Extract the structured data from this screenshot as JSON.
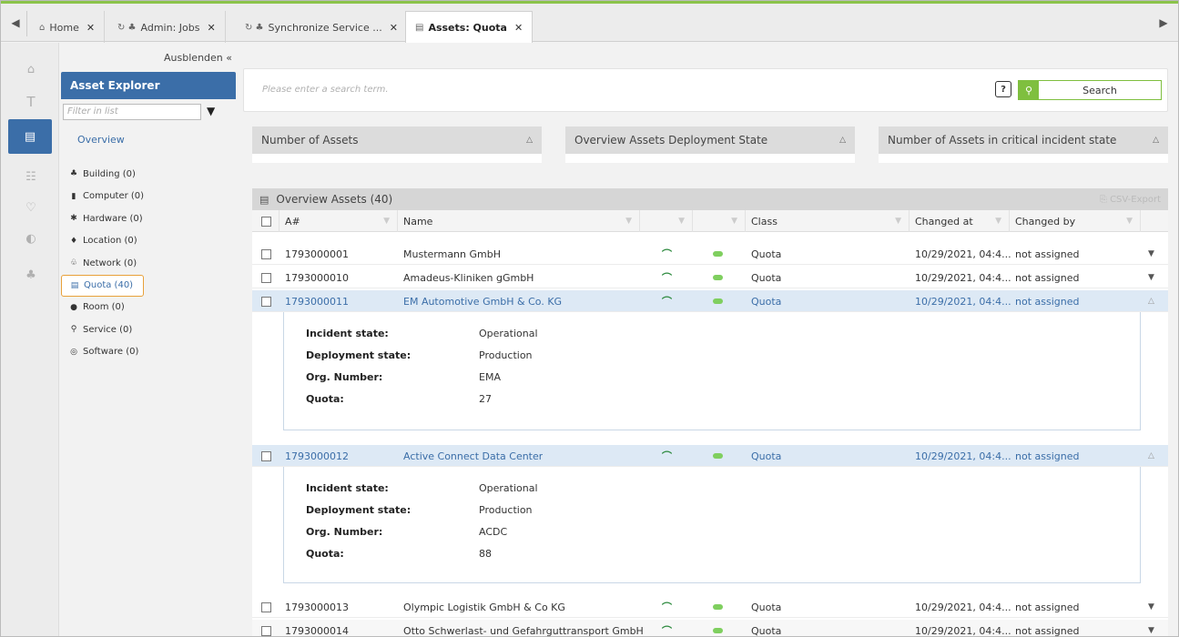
{
  "tabs": [
    {
      "label": "Home",
      "icon": "home-icon",
      "icon_glyph": "⌂"
    },
    {
      "label": "Admin: Jobs",
      "icon": "sync-icon",
      "icon_glyph": "↻ ♣"
    },
    {
      "label": "Synchronize Service ...",
      "icon": "sync-icon",
      "icon_glyph": "↻ ♣"
    },
    {
      "label": "Assets: Quota",
      "icon": "database-icon",
      "icon_glyph": "▤"
    }
  ],
  "explorer": {
    "hide_label": "Ausblenden «",
    "title": "Asset Explorer",
    "filter_placeholder": "Filter in list",
    "overview_label": "Overview",
    "items": [
      {
        "label": "Building (0)",
        "icon": "building-icon",
        "glyph": "♣"
      },
      {
        "label": "Computer (0)",
        "icon": "computer-icon",
        "glyph": "▮"
      },
      {
        "label": "Hardware (0)",
        "icon": "gear-icon",
        "glyph": "✱"
      },
      {
        "label": "Location (0)",
        "icon": "location-icon",
        "glyph": "♦"
      },
      {
        "label": "Network (0)",
        "icon": "network-icon",
        "glyph": "♧"
      },
      {
        "label": "Quota (40)",
        "icon": "database-icon",
        "glyph": "▤"
      },
      {
        "label": "Room (0)",
        "icon": "room-icon",
        "glyph": "●"
      },
      {
        "label": "Service (0)",
        "icon": "service-icon",
        "glyph": "⚲"
      },
      {
        "label": "Software (0)",
        "icon": "software-icon",
        "glyph": "◎"
      }
    ]
  },
  "search": {
    "placeholder": "Please enter a search term.",
    "help_glyph": "?",
    "button_label": "Search"
  },
  "widgets": [
    {
      "title": "Number of Assets"
    },
    {
      "title": "Overview Assets Deployment State"
    },
    {
      "title": "Number of Assets in critical incident state"
    }
  ],
  "grid": {
    "title": "Overview Assets (40)",
    "csv_label": "CSV-Export",
    "columns": [
      "A#",
      "Name",
      "",
      "",
      "Class",
      "Changed at",
      "Changed by"
    ],
    "rows": [
      {
        "id": "1793000001",
        "name": "Mustermann GmbH",
        "class": "Quota",
        "changed_at": "10/29/2021, 04:4...",
        "changed_by": "not assigned"
      },
      {
        "id": "1793000010",
        "name": "Amadeus-Kliniken gGmbH",
        "class": "Quota",
        "changed_at": "10/29/2021, 04:4...",
        "changed_by": "not assigned"
      },
      {
        "id": "1793000011",
        "name": "EM Automotive GmbH & Co. KG",
        "class": "Quota",
        "changed_at": "10/29/2021, 04:4...",
        "changed_by": "not assigned"
      },
      {
        "id": "1793000012",
        "name": "Active Connect Data Center",
        "class": "Quota",
        "changed_at": "10/29/2021, 04:4...",
        "changed_by": "not assigned"
      },
      {
        "id": "1793000013",
        "name": "Olympic Logistik GmbH & Co KG",
        "class": "Quota",
        "changed_at": "10/29/2021, 04:4...",
        "changed_by": "not assigned"
      },
      {
        "id": "1793000014",
        "name": "Otto Schwerlast- und Gefahrguttransport GmbH",
        "class": "Quota",
        "changed_at": "10/29/2021, 04:4...",
        "changed_by": "not assigned"
      }
    ],
    "details": [
      {
        "incident_label": "Incident state:",
        "incident": "Operational",
        "deployment_label": "Deployment state:",
        "deployment": "Production",
        "org_label": "Org. Number:",
        "org": "EMA",
        "quota_label": "Quota:",
        "quota": "27"
      },
      {
        "incident_label": "Incident state:",
        "incident": "Operational",
        "deployment_label": "Deployment state:",
        "deployment": "Production",
        "org_label": "Org. Number:",
        "org": "ACDC",
        "quota_label": "Quota:",
        "quota": "88"
      }
    ]
  },
  "colors": {
    "accent": "#3b6ea8",
    "green": "#7fbf3f",
    "selected_row": "#dde9f5",
    "highlight_border": "#e8a13a"
  }
}
